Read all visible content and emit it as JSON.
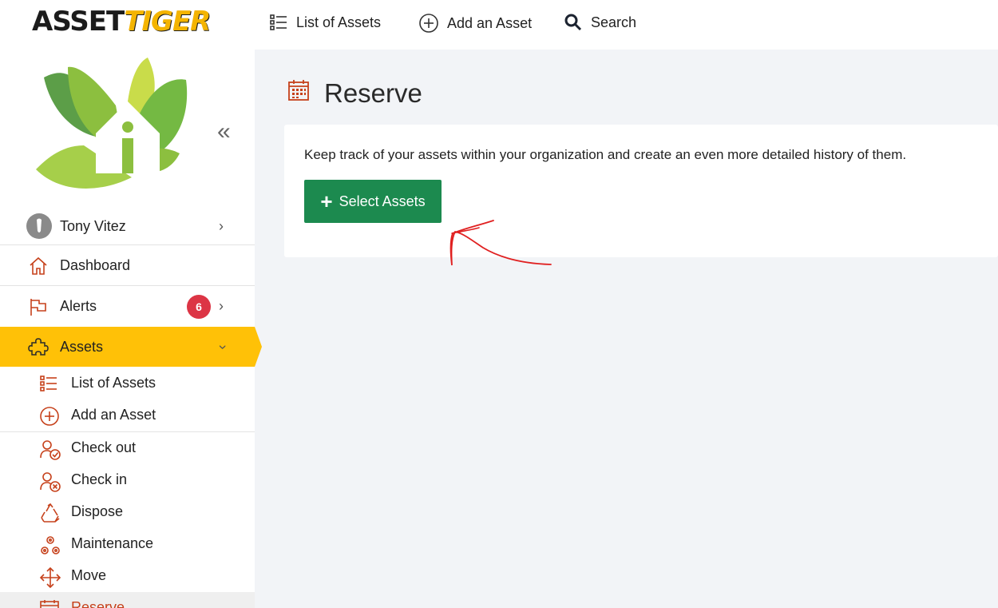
{
  "brand": {
    "part1": "ASSET",
    "part2": "TIGER"
  },
  "topnav": {
    "list_label": "List of Assets",
    "add_label": "Add an Asset",
    "search_label": "Search"
  },
  "sidebar": {
    "collapse_glyph": "«",
    "user": {
      "name": "Tony Vitez"
    },
    "dashboard_label": "Dashboard",
    "alerts": {
      "label": "Alerts",
      "count": "6"
    },
    "assets_label": "Assets",
    "chevron_right": "›",
    "submenu": [
      {
        "label": "List of Assets",
        "icon": "list-icon"
      },
      {
        "label": "Add an Asset",
        "icon": "plus-circle-icon"
      },
      {
        "label": "Check out",
        "icon": "user-check-icon"
      },
      {
        "label": "Check in",
        "icon": "user-x-icon"
      },
      {
        "label": "Dispose",
        "icon": "recycle-icon"
      },
      {
        "label": "Maintenance",
        "icon": "gears-icon"
      },
      {
        "label": "Move",
        "icon": "move-arrows-icon"
      },
      {
        "label": "Reserve",
        "icon": "calendar-icon"
      }
    ]
  },
  "main": {
    "title": "Reserve",
    "description": "Keep track of your assets within your organization and create an even more detailed history of them.",
    "select_button_label": "Select Assets",
    "plus_glyph": "+"
  },
  "colors": {
    "accent_orange": "#c6411b",
    "active_yellow": "#ffc107",
    "button_green": "#1c8a4f",
    "badge_red": "#dc3545",
    "annotation_red": "#e02020"
  }
}
